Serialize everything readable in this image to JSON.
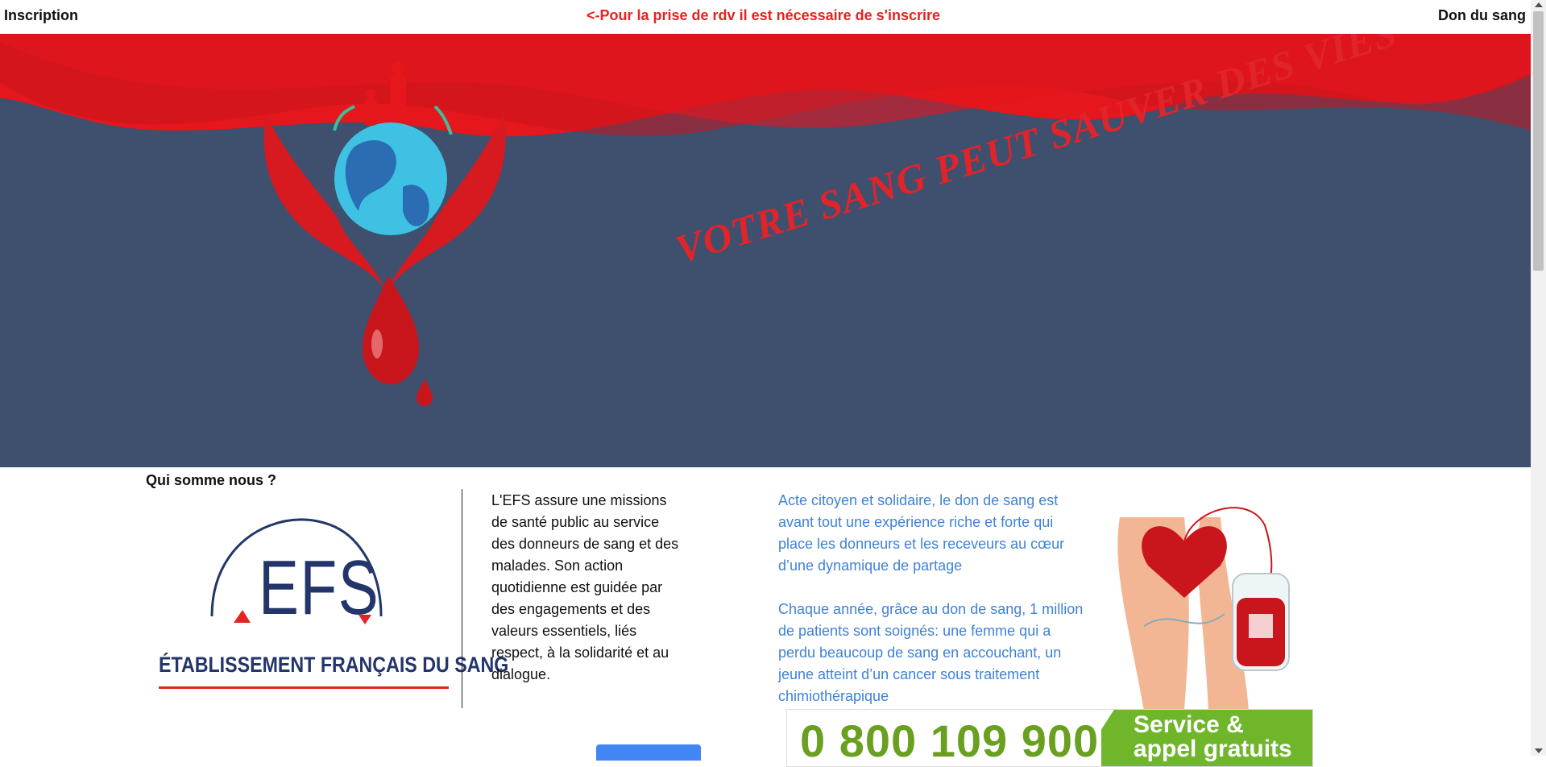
{
  "nav": {
    "left_link": "Inscription",
    "notice": "<-Pour la prise de rdv il est nécessaire de s'inscrire",
    "right_link": "Don du sang"
  },
  "hero": {
    "slogan": "VOTRE SANG PEUT SAUVER DES VIES",
    "bg_color": "#3f4f6e",
    "wave_color": "#e52320"
  },
  "about": {
    "title": "Qui somme nous ?",
    "logo_letters": "EFS",
    "logo_fullname": "ÉTABLISSEMENT FRANÇAIS DU SANG",
    "mission_text": "L'EFS assure une missions de santé public au service des donneurs de sang et des malades. Son action quotidienne est guidée par des engagements et des valeurs essentiels, liés respect, à la solidarité et au dialogue.",
    "blue_paragraphs": [
      "Acte citoyen et solidaire, le don de sang est avant tout une expérience riche et forte qui place les donneurs et les receveurs au cœur d’une dynamique de partage",
      "Chaque année, grâce au don de sang, 1 million de patients sont soignés: une femme qui a perdu beaucoup de sang en accouchant, un jeune atteint d’un cancer sous traitement chimiothérapique"
    ]
  },
  "phone_banner": {
    "number": "0 800 109 900",
    "service_label": "Service & appel gratuits"
  },
  "colors": {
    "accent_red": "#e52320",
    "navy": "#23356b",
    "text_blue": "#3f82d8",
    "phone_green": "#6aa01f"
  }
}
